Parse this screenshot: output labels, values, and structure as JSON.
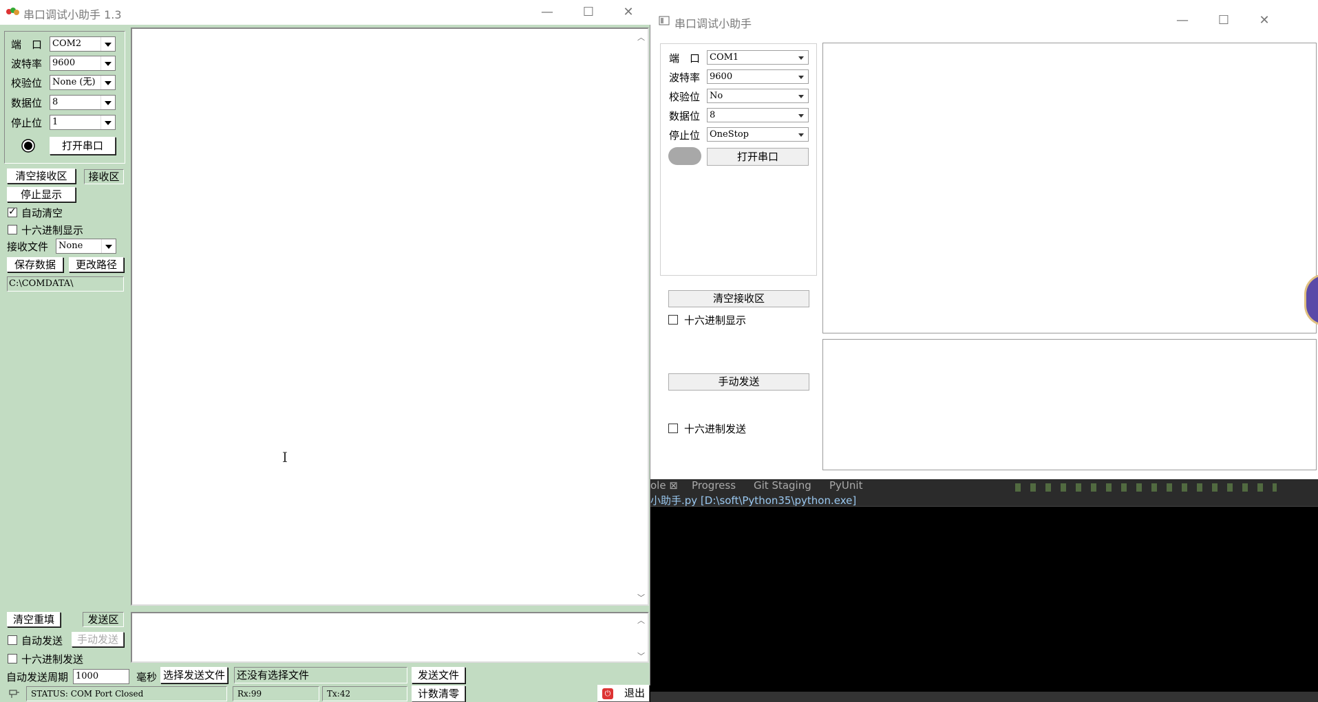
{
  "win1": {
    "title": "串口调试小助手 1.3",
    "settings": [
      {
        "label": "端　口",
        "value": "COM2"
      },
      {
        "label": "波特率",
        "value": "9600"
      },
      {
        "label": "校验位",
        "value": "None (无)"
      },
      {
        "label": "数据位",
        "value": "8"
      },
      {
        "label": "停止位",
        "value": "1"
      }
    ],
    "open_port": "打开串口",
    "clear_receive": "清空接收区",
    "receive_area": "接收区",
    "stop_display": "停止显示",
    "auto_clear": "自动清空",
    "hex_display": "十六进制显示",
    "receive_file_label": "接收文件",
    "receive_file_value": "None",
    "save_data": "保存数据",
    "change_path": "更改路径",
    "path": "C:\\COMDATA\\",
    "clear_refill": "清空重填",
    "send_area": "发送区",
    "auto_send": "自动发送",
    "manual_send": "手动发送",
    "hex_send": "十六进制发送",
    "auto_period_label": "自动发送周期",
    "auto_period_value": "1000",
    "ms": "毫秒",
    "choose_file": "选择发送文件",
    "no_file": "还没有选择文件",
    "send_file": "发送文件",
    "status": "STATUS: COM Port Closed",
    "rx": "Rx:99",
    "tx": "Tx:42",
    "reset_count": "计数清零",
    "exit": "退出",
    "auto_clear_checked": true
  },
  "win2": {
    "title": "串口调试小助手",
    "settings": [
      {
        "label": "端　口",
        "value": "COM1"
      },
      {
        "label": "波特率",
        "value": "9600"
      },
      {
        "label": "校验位",
        "value": "No"
      },
      {
        "label": "数据位",
        "value": "8"
      },
      {
        "label": "停止位",
        "value": "OneStop"
      }
    ],
    "open_port": "打开串口",
    "clear_receive": "清空接收区",
    "hex_display": "十六进制显示",
    "manual_send": "手动发送",
    "hex_send": "十六进制发送"
  },
  "ide": {
    "tabs": [
      "ole ⊠",
      "Progress",
      "Git Staging",
      "PyUnit"
    ],
    "path": "小助手.py [D:\\soft\\Python35\\python.exe]"
  },
  "caption": {
    "minimize": "—",
    "maximize": "☐",
    "close": "✕"
  }
}
